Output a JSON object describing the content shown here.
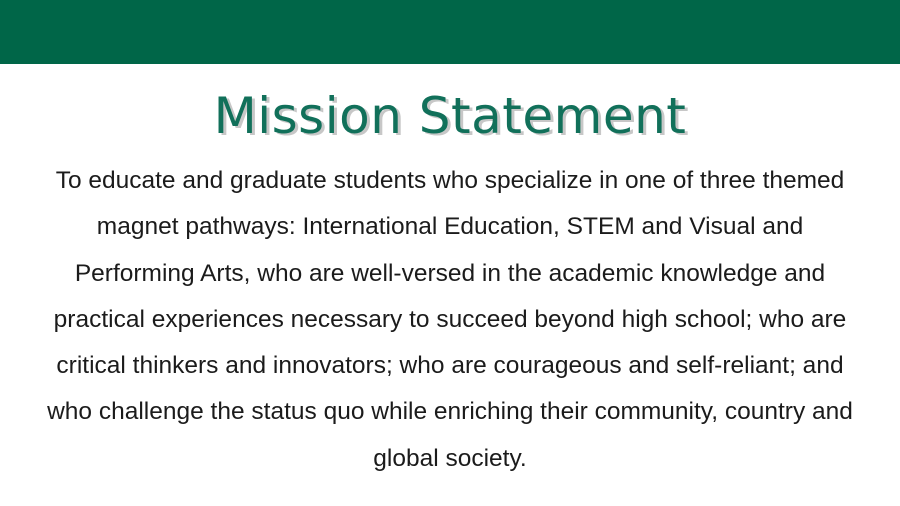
{
  "slide": {
    "title": "Mission Statement",
    "body": "To educate and graduate students who specialize in one of three themed magnet pathways: International Education, STEM and Visual and Performing Arts, who are well-versed in the academic knowledge and practical experiences necessary to succeed beyond high school; who are critical thinkers and innovators; who are courageous and self-reliant; and who challenge the status quo while enriching their community, country and global society."
  },
  "colors": {
    "banner": "#006648",
    "title": "#11705a",
    "title_shadow": "#c7c7c7",
    "body_text": "#1b1b1b",
    "background": "#ffffff"
  }
}
